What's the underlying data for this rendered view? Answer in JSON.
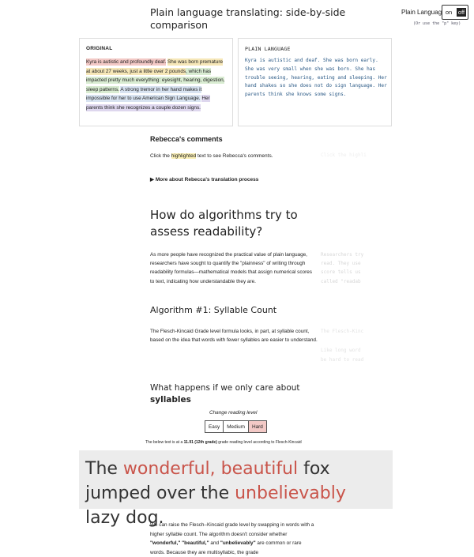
{
  "header": {
    "title": "Plain language translating: side-by-side comparison",
    "toggle_label": "Plain Language",
    "toggle_on": "on",
    "toggle_off": "off",
    "toggle_hint": "(Or use the \"p\" key)"
  },
  "original": {
    "label": "ORIGINAL",
    "segments": [
      {
        "text": "Kyra is autistic and profoundly deaf.",
        "color": "red"
      },
      {
        "text": " "
      },
      {
        "text": "She was born premature at about 27 weeks, just a little over 2 pounds",
        "color": "yel"
      },
      {
        "text": ", which has impacted pretty much everything: eyesight, hearing, digestion, sleep patterns.",
        "color": "grn"
      },
      {
        "text": " "
      },
      {
        "text": "A strong tremor in her hand makes it impossible for her to use American Sign Language.",
        "color": "blu"
      },
      {
        "text": " "
      },
      {
        "text": "Her parents think she recognizes a couple dozen signs.",
        "color": "pur"
      }
    ]
  },
  "plain": {
    "label": "PLAIN LANGUAGE",
    "text": "Kyra is autistic and deaf. She was born early. She was very small when she was born. She has trouble seeing, hearing, eating and sleeping. Her hand shakes so she does not do sign language. Her parents think she knows some signs."
  },
  "comments": {
    "heading": "Rebecca's comments",
    "text_before": "Click the ",
    "highlighted": "highlighted",
    "text_after": " text to see Rebecca's comments.",
    "side_note": "Click the highli",
    "more_about": "More about Rebecca's translation process"
  },
  "algorithms": {
    "heading": "How do algorithms try to assess readability?",
    "paragraph": "As more people have recognized the practical value of plain language, researchers have sought to quantify the \"plainness\" of writing through readability formulas—mathematical models that assign numerical scores to text, indicating how understandable they are.",
    "side_note": "Researchers try\nread. They use \nscore tells us \ncalled \"readab",
    "algo1_heading": "Algorithm #1: Syllable Count",
    "algo1_paragraph": "The Flesch-Kincaid Grade level formula looks, in part, at syllable count, based on the idea that words with fewer syllables are easier to understand.",
    "algo1_side_note": "The Flesch-Kinc\n\nLike long word\nbe hard to read"
  },
  "syllables": {
    "heading_prefix": "What happens if we only care about",
    "heading_bold": "syllables",
    "change_label": "Change reading level",
    "levels": [
      "Easy",
      "Medium",
      "Hard"
    ],
    "active_level": "Hard",
    "desc_prefix": "The below text is at a ",
    "desc_grade": "11.91 (12th grade)",
    "desc_suffix": " grade reading level according to Flesch-Kincaid",
    "example_the": "The ",
    "example_red1": "wonderful, beautiful",
    "example_mid": " fox jumped over the ",
    "example_red2": "unbelievably",
    "example_end": " lazy dog.",
    "bottom_before": "We can raise the Flesch–Kincaid grade level by swapping in words with a higher syllable count. The algorithm doesn't consider whether ",
    "bottom_bold": "\"wonderful,\" \"beautiful,\"",
    "bottom_mid": " and ",
    "bottom_bold2": "\"unbelievably\"",
    "bottom_after": " are common or rare words. Because they are multisyllabic, the grade"
  },
  "colors": {
    "highlight_red": "#f3c9c6",
    "highlight_yellow": "#f6e7b8",
    "highlight_green": "#d9ecd2",
    "highlight_blue": "#d8e3f1",
    "highlight_purple": "#ded7ee",
    "plain_text": "#2b5a86",
    "accent_red": "#c9544a"
  }
}
